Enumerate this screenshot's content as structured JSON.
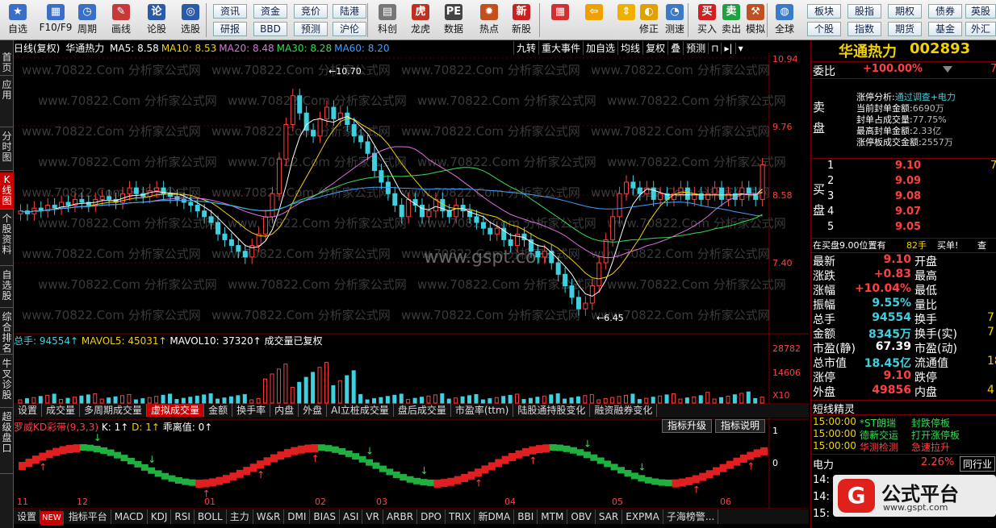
{
  "toolbar": {
    "buttons": [
      {
        "name": "自选",
        "icon": "star-icon"
      },
      {
        "name": "F10/F9",
        "icon": "f10-icon"
      },
      {
        "name": "周期",
        "icon": "clock-icon"
      },
      {
        "name": "画线",
        "icon": "pencil-icon"
      },
      {
        "name": "论股",
        "icon": "discuss-icon"
      },
      {
        "name": "选股",
        "icon": "select-stock-icon"
      },
      {
        "name": "科创",
        "icon": "kechuang-icon"
      },
      {
        "name": "龙虎",
        "icon": "dragon-tiger-icon"
      },
      {
        "name": "数据",
        "icon": "pe-data-icon"
      },
      {
        "name": "热点",
        "icon": "hot-icon"
      },
      {
        "name": "新股",
        "icon": "new-stock-icon"
      },
      {
        "name": "",
        "icon": "layout-icon"
      },
      {
        "name": "",
        "icon": "back-arrow-icon"
      },
      {
        "name": "",
        "icon": "up-down-arrow-icon"
      },
      {
        "name": "修正",
        "icon": "correction-icon"
      },
      {
        "name": "测速",
        "icon": "speed-test-icon"
      },
      {
        "name": "买入",
        "icon": "buy-icon",
        "glyph": "买"
      },
      {
        "name": "卖出",
        "icon": "sell-icon",
        "glyph": "卖"
      },
      {
        "name": "模拟",
        "icon": "hammer-icon"
      },
      {
        "name": "全球",
        "icon": "globe-icon"
      }
    ],
    "pills": [
      "资讯",
      "资金",
      "竞价",
      "陆港",
      "研报",
      "BBD",
      "预测",
      "沪伦",
      "板块",
      "股指",
      "期权",
      "债券",
      "英股",
      "个股",
      "指数",
      "期货",
      "基金",
      "外汇"
    ]
  },
  "left_tabs": [
    "首页",
    "应用",
    "分时图",
    "K线图",
    "个股资料",
    "自选股",
    "综合排名",
    "牛叉诊股",
    "超级盘口"
  ],
  "chart_header": {
    "title": "日线(复权)",
    "stock": "华通热力",
    "ma": [
      {
        "label": "MA5: 8.58",
        "color": "#ffffff"
      },
      {
        "label": "MA10: 8.53",
        "color": "#f2d200"
      },
      {
        "label": "MA20: 8.48",
        "color": "#e070e0"
      },
      {
        "label": "MA30: 8.28",
        "color": "#33dd55"
      },
      {
        "label": "MA60: 8.20",
        "color": "#3fa0ff"
      }
    ],
    "menu": [
      "九转",
      "重大事件",
      "加自选",
      "均线",
      "复权",
      "叠",
      "预测"
    ]
  },
  "price_axis": [
    "10.94",
    "9.76",
    "8.58",
    "7.40"
  ],
  "price_marks": {
    "high": "10.70",
    "low": "6.45"
  },
  "vol_header": {
    "total": "总手: 94554↑",
    "mavol5": "MAVOL5: 45031↑",
    "mavol10": "MAVOL10: 37320↑",
    "note": "成交量已复权"
  },
  "vol_axis": [
    "28782",
    "14606",
    "X10"
  ],
  "vol_tabs": [
    "设置",
    "成交量",
    "多周期成交量",
    "虚拟成交量",
    "金额",
    "换手率",
    "内盘",
    "外盘",
    "AI立桩成交量",
    "盘后成交量",
    "市盈率(ttm)",
    "陆股通持股变化",
    "融资融券变化"
  ],
  "vol_tab_active": 3,
  "indicator": {
    "name": "罗威KD彩带(9,3,3)",
    "k": "K: 1↑",
    "d": "D: 1↑",
    "dev": "乖离值: 0↑",
    "btn_upgrade": "指标升级",
    "btn_help": "指标说明",
    "axis": [
      "1",
      "0"
    ]
  },
  "months": [
    "11",
    "12",
    "01",
    "02",
    "03",
    "04",
    "05",
    "06"
  ],
  "bottom_tabs": [
    "设置",
    "指标平台",
    "MACD",
    "KDJ",
    "RSI",
    "BOLL",
    "主力",
    "W&R",
    "DMI",
    "BIAS",
    "ASI",
    "VR",
    "ARBR",
    "DPO",
    "TRIX",
    "新DMA",
    "BBI",
    "MTM",
    "OBV",
    "SAR",
    "EXPMA",
    "子海榜警..."
  ],
  "new_badge": "NEW",
  "watermarks": {
    "site": "www.70822.Com 分析家公式网",
    "center": "www.gspt.com"
  },
  "panel": {
    "stock_name": "华通热力",
    "stock_code": "002893",
    "weibi_label": "委比",
    "weibi_value": "+100.00%",
    "weibi_trail": "7",
    "sell_label": "卖盘",
    "buy_label": "买盘",
    "limit_info": [
      {
        "k": "涨停分析:",
        "v": "通过调查+电力"
      },
      {
        "k": "当前封单金额:",
        "v": "6690万"
      },
      {
        "k": "封单占成交量:",
        "v": "77.75%"
      },
      {
        "k": "最高封单金额:",
        "v": "2.33亿"
      },
      {
        "k": "涨停板成交金额:",
        "v": "2557万"
      }
    ],
    "bids": [
      {
        "lvl": "1",
        "price": "9.10",
        "vol": "7"
      },
      {
        "lvl": "2",
        "price": "9.09",
        "vol": ""
      },
      {
        "lvl": "3",
        "price": "9.08",
        "vol": ""
      },
      {
        "lvl": "4",
        "price": "9.07",
        "vol": ""
      },
      {
        "lvl": "5",
        "price": "9.05",
        "vol": ""
      }
    ],
    "buy_line": {
      "a": "在买盘9.00位置有",
      "b": "82手",
      "c": "买单!",
      "d": "查"
    },
    "quote": [
      {
        "l1": "最新",
        "v1": "9.10",
        "c1": "red",
        "l2": "开盘",
        "v2": ""
      },
      {
        "l1": "涨跌",
        "v1": "+0.83",
        "c1": "red",
        "l2": "最高",
        "v2": ""
      },
      {
        "l1": "涨幅",
        "v1": "+10.04%",
        "c1": "red",
        "l2": "最低",
        "v2": ""
      },
      {
        "l1": "振幅",
        "v1": "9.55%",
        "c1": "cyan",
        "l2": "量比",
        "v2": ""
      },
      {
        "l1": "总手",
        "v1": "94554",
        "c1": "cyan",
        "l2": "换手",
        "v2": "7"
      },
      {
        "l1": "金额",
        "v1": "8345万",
        "c1": "cyan",
        "l2": "换手(实)",
        "v2": "7"
      },
      {
        "l1": "市盈(静)",
        "v1": "67.39",
        "c1": "white",
        "l2": "市盈(动)",
        "v2": ""
      },
      {
        "l1": "总市值",
        "v1": "18.45亿",
        "c1": "cyan",
        "l2": "流通值",
        "v2": "18."
      },
      {
        "l1": "涨停",
        "v1": "9.10",
        "c1": "red",
        "l2": "跌停",
        "v2": ""
      },
      {
        "l1": "外盘",
        "v1": "49856",
        "c1": "red",
        "l2": "内盘",
        "v2": "4"
      }
    ],
    "short_title": "短线精灵",
    "short_list": [
      {
        "t": "15:00:00",
        "n": "*ST朗瑞",
        "e": "封跌停板",
        "c": "green"
      },
      {
        "t": "15:00:00",
        "n": "德新交运",
        "e": "打开涨停板",
        "c": "green"
      },
      {
        "t": "15:00:00",
        "n": "华测检测",
        "e": "急速拉升",
        "c": "red"
      }
    ],
    "sector": {
      "name": "电力",
      "pct": "2.26%",
      "btn": "同行业"
    },
    "bottom_times": [
      "14:",
      "14:",
      "15:"
    ]
  },
  "brand": {
    "name": "公式平台",
    "site": "www.gspt.com",
    "glyph": "G"
  }
}
